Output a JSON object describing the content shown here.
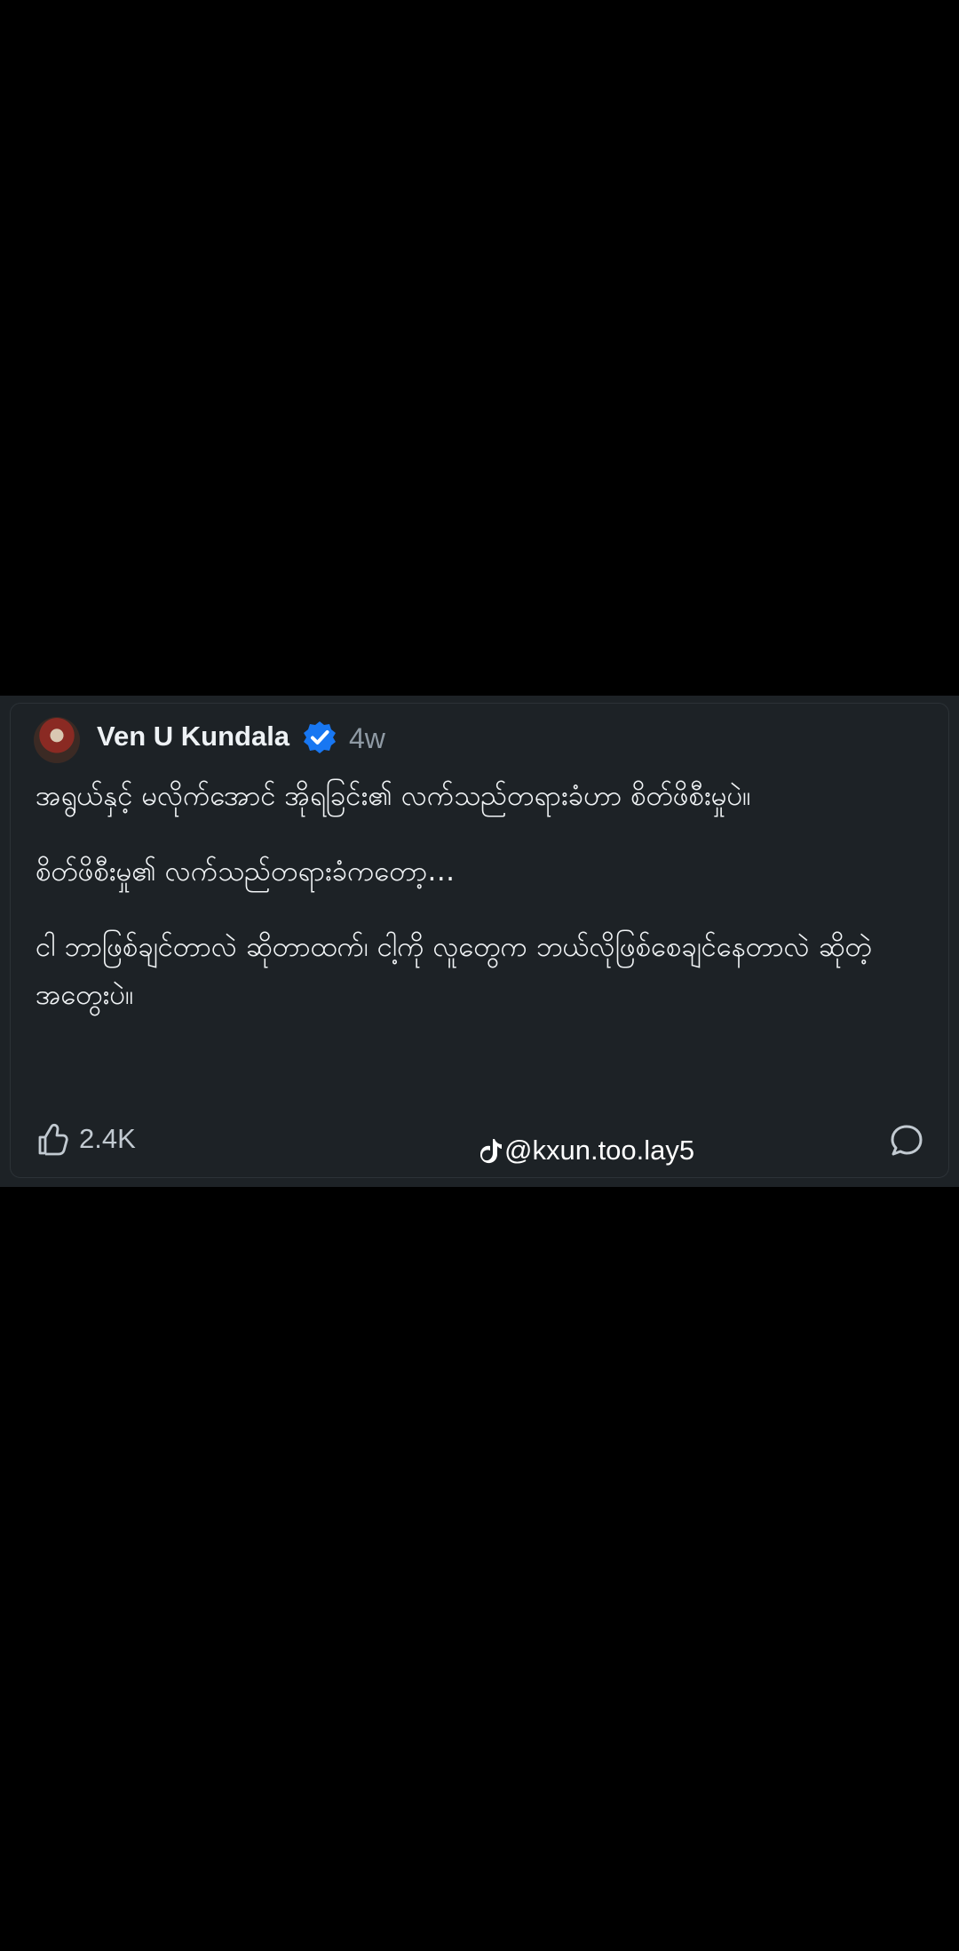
{
  "post": {
    "author": "Ven U Kundala",
    "time": "4w",
    "body_lines": [
      "အရွယ်နှင့် မလိုက်အောင် အိုရခြင်း၏ လက်သည်တရားခံဟာ စိတ်ဖိစီးမှုပဲ။",
      "စိတ်ဖိစီးမှု၏ လက်သည်တရားခံကတော့…",
      "ငါ ဘာဖြစ်ချင်တာလဲ ဆိုတာထက်၊ ငါ့ကို လူတွေက ဘယ်လိုဖြစ်စေချင်နေတာလဲ ဆိုတဲ့ အတွေးပဲ။"
    ],
    "likes": "2.4K",
    "watermark": "@kxun.too.lay5"
  },
  "icons": {
    "avatar": "profile-avatar",
    "verified": "verified-badge-icon",
    "like": "thumbs-up-icon",
    "tiktok": "tiktok-icon",
    "comment": "comment-icon"
  },
  "colors": {
    "background": "#000000",
    "card": "#1d2226",
    "verified": "#1877f2",
    "text": "#f1f4f6",
    "muted": "#8f9aa4"
  }
}
